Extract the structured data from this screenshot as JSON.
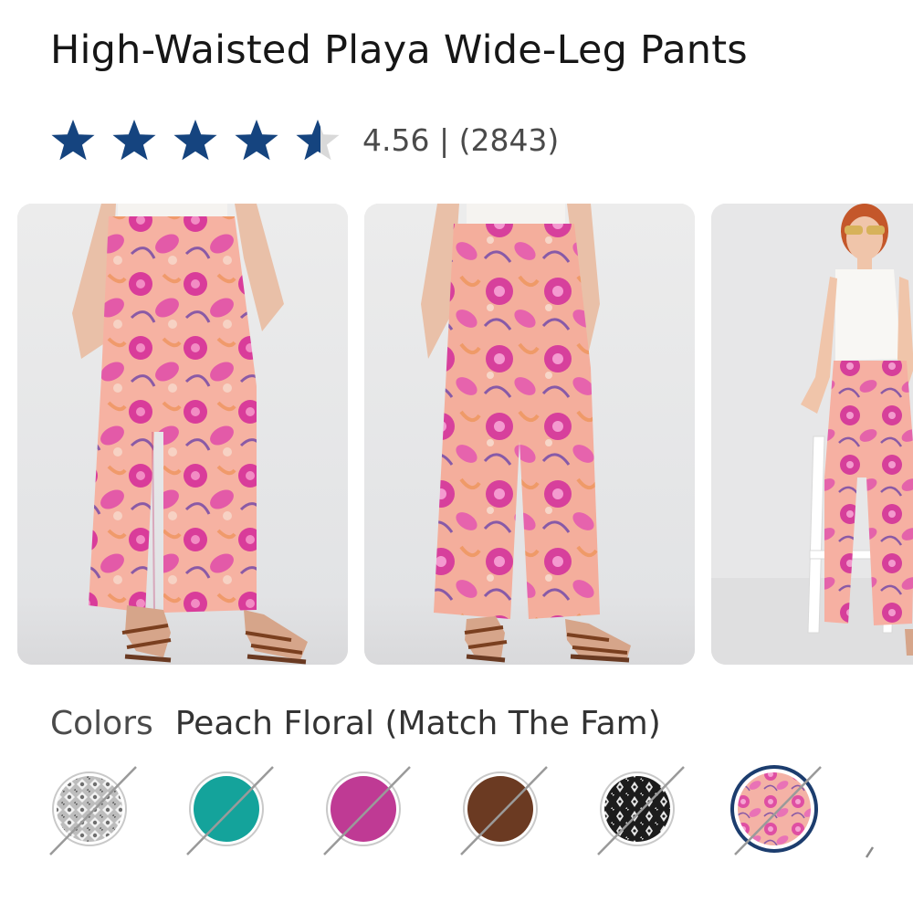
{
  "product": {
    "title": "High-Waisted Playa Wide-Leg Pants",
    "rating_value": 4.56,
    "rating_text": "4.56 | (2843)",
    "review_count": 2843,
    "stars_total": 5,
    "star_color": "#15447f"
  },
  "gallery": {
    "photos": [
      {
        "name": "front view"
      },
      {
        "name": "back view"
      },
      {
        "name": "model seated on stool"
      }
    ]
  },
  "colors": {
    "label": "Colors",
    "selected_name": "Peach Floral (Match The Fam)",
    "swatches": [
      {
        "pattern": "gray-geometric",
        "color": "#a9a9a9",
        "unavailable": true,
        "selected": false
      },
      {
        "pattern": "solid",
        "color": "#14a39b",
        "unavailable": true,
        "selected": false
      },
      {
        "pattern": "solid",
        "color": "#bf3a94",
        "unavailable": true,
        "selected": false
      },
      {
        "pattern": "solid",
        "color": "#6b3a22",
        "unavailable": true,
        "selected": false
      },
      {
        "pattern": "black-damask",
        "color": "#1c1c1c",
        "unavailable": true,
        "selected": false
      },
      {
        "pattern": "peach-floral",
        "color": "#f2a7a0",
        "unavailable": true,
        "selected": true
      }
    ],
    "selected_ring_color": "#1c3d6e"
  }
}
